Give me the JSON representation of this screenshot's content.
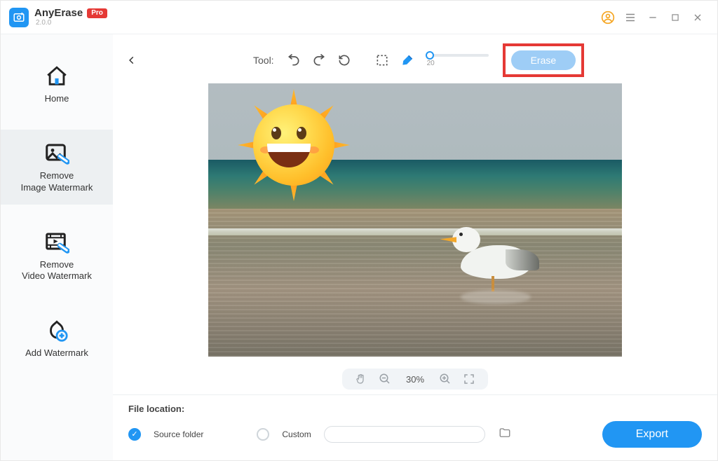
{
  "app": {
    "name": "AnyErase",
    "version": "2.0.0",
    "badge": "Pro"
  },
  "sidebar": {
    "items": [
      {
        "label": "Home"
      },
      {
        "label": "Remove\nImage Watermark"
      },
      {
        "label": "Remove\nVideo Watermark"
      },
      {
        "label": "Add Watermark"
      }
    ],
    "selected_index": 1
  },
  "toolbar": {
    "tool_label": "Tool:",
    "brush_size": 20,
    "erase_label": "Erase"
  },
  "zoom": {
    "value": "30%"
  },
  "footer": {
    "file_location_label": "File location:",
    "source_folder_label": "Source folder",
    "custom_label": "Custom",
    "custom_path": "",
    "export_label": "Export",
    "selected_option": "source"
  },
  "colors": {
    "accent": "#2196f3",
    "highlight_box": "#e53935",
    "pro_badge": "#e53935"
  }
}
